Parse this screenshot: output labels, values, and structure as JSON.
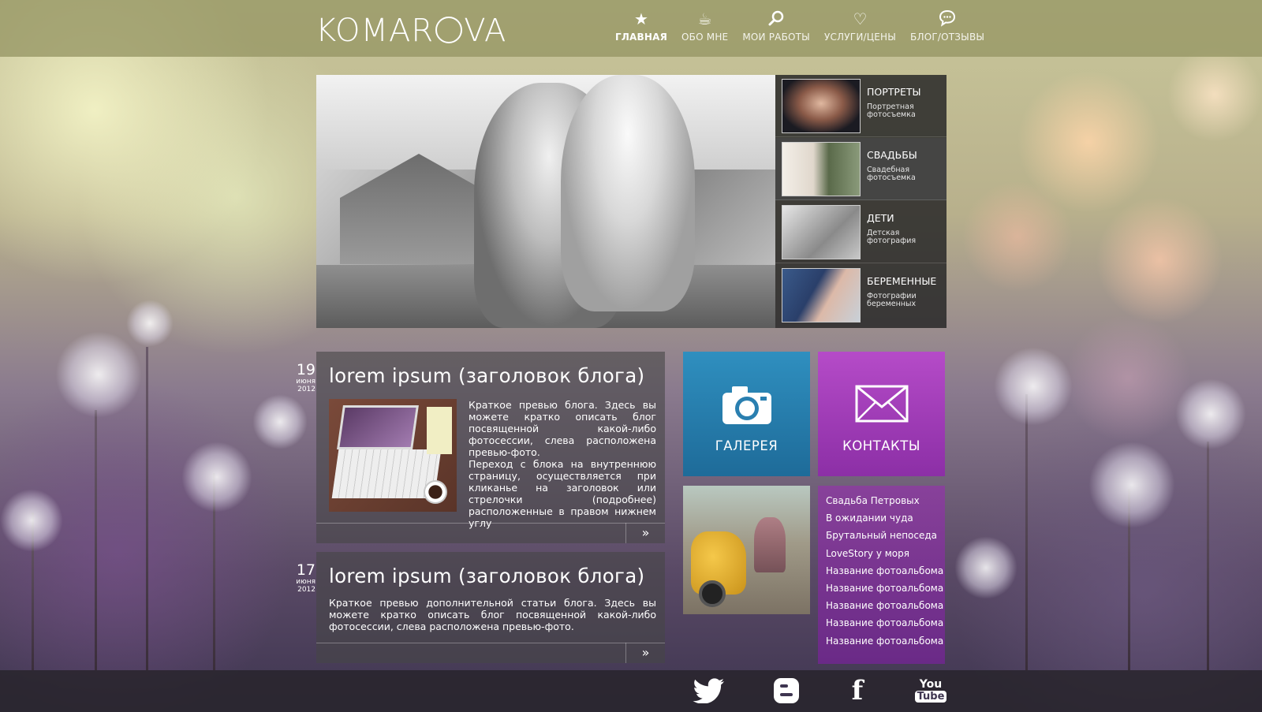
{
  "site": {
    "logo": "KOMAROVA",
    "logo_pre": "KOMAR",
    "logo_post": "VA"
  },
  "nav": [
    {
      "label": "ГЛАВНАЯ",
      "icon": "star-icon",
      "active": true
    },
    {
      "label": "ОБО МНЕ",
      "icon": "coffee-cup-icon"
    },
    {
      "label": "МОИ РАБОТЫ",
      "icon": "magnifier-icon"
    },
    {
      "label": "УСЛУГИ/ЦЕНЫ",
      "icon": "heart-icon"
    },
    {
      "label": "БЛОГ/ОТЗЫВЫ",
      "icon": "speech-bubble-icon"
    }
  ],
  "categories": [
    {
      "title": "ПОРТРЕТЫ",
      "subtitle": "Портретная фотосъемка"
    },
    {
      "title": "СВАДЬБЫ",
      "subtitle": "Свадебная фотосъемка"
    },
    {
      "title": "ДЕТИ",
      "subtitle": "Детская фотография"
    },
    {
      "title": "БЕРЕМЕННЫЕ",
      "subtitle": "Фотографии беременных"
    }
  ],
  "posts": [
    {
      "day": "19",
      "month": "июня",
      "year": "2012",
      "title": "lorem ipsum (заголовок блога)",
      "text1": "Краткое превью блога. Здесь вы можете кратко описать блог посвященной какой-либо фотосессии, слева расположена превью-фото.",
      "text2": "Переход с блока на внутреннюю страницу, осуществляется при кликанье на заголовок или стрелочки (подробнее) расположенные в правом нижнем углу",
      "more": "»"
    },
    {
      "day": "17",
      "month": "июня",
      "year": "2012",
      "title": "lorem ipsum (заголовок блога)",
      "text1": "Краткое превью дополнительной статьи блога. Здесь вы можете кратко описать блог посвященной какой-либо фотосессии, слева расположена превью-фото.",
      "more": "»"
    }
  ],
  "tiles": {
    "gallery": {
      "label": "ГАЛЕРЕЯ",
      "icon": "camera-icon",
      "color": "#2a86b6"
    },
    "contacts": {
      "label": "КОНТАКТЫ",
      "icon": "envelope-icon",
      "color": "#a63fc0"
    }
  },
  "albums": [
    "Свадьба Петровых",
    "В ожидании чуда",
    "Брутальный непоседа",
    "LoveStory у моря",
    "Название фотоальбома",
    "Название фотоальбома",
    "Название фотоальбома",
    "Название фотоальбома",
    "Название фотоальбома"
  ],
  "social": [
    {
      "name": "twitter-icon"
    },
    {
      "name": "blogger-icon"
    },
    {
      "name": "facebook-icon",
      "glyph": "f"
    },
    {
      "name": "youtube-icon",
      "glyph_top": "You",
      "glyph_bottom": "Tube"
    }
  ]
}
